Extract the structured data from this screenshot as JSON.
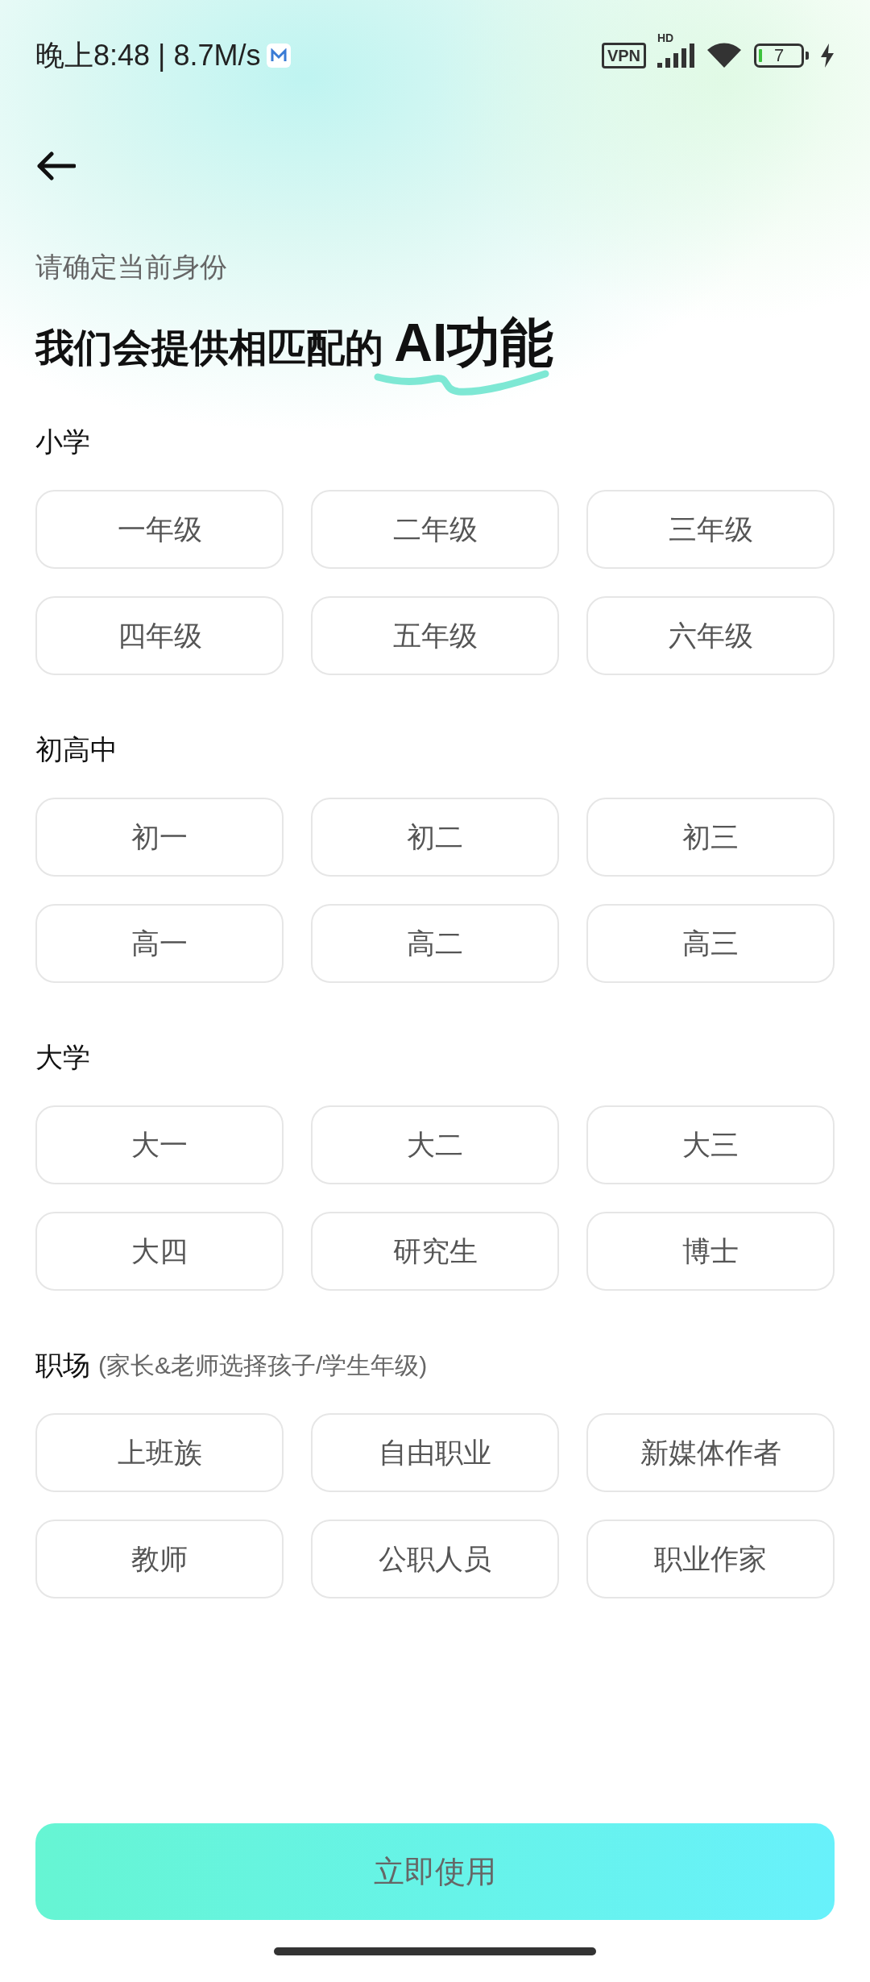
{
  "status_bar": {
    "time_speed": "晚上8:48 | 8.7M/s",
    "vpn": "VPN",
    "network": "HD",
    "battery": "7"
  },
  "subtitle": "请确定当前身份",
  "title": {
    "text": "我们会提供相匹配的",
    "highlight": "AI功能"
  },
  "sections": [
    {
      "label": "小学",
      "options": [
        "一年级",
        "二年级",
        "三年级",
        "四年级",
        "五年级",
        "六年级"
      ]
    },
    {
      "label": "初高中",
      "options": [
        "初一",
        "初二",
        "初三",
        "高一",
        "高二",
        "高三"
      ]
    },
    {
      "label": "大学",
      "options": [
        "大一",
        "大二",
        "大三",
        "大四",
        "研究生",
        "博士"
      ]
    },
    {
      "label": "职场",
      "note": "(家长&老师选择孩子/学生年级)",
      "options": [
        "上班族",
        "自由职业",
        "新媒体作者",
        "教师",
        "公职人员",
        "职业作家"
      ]
    }
  ],
  "primary_button": "立即使用"
}
